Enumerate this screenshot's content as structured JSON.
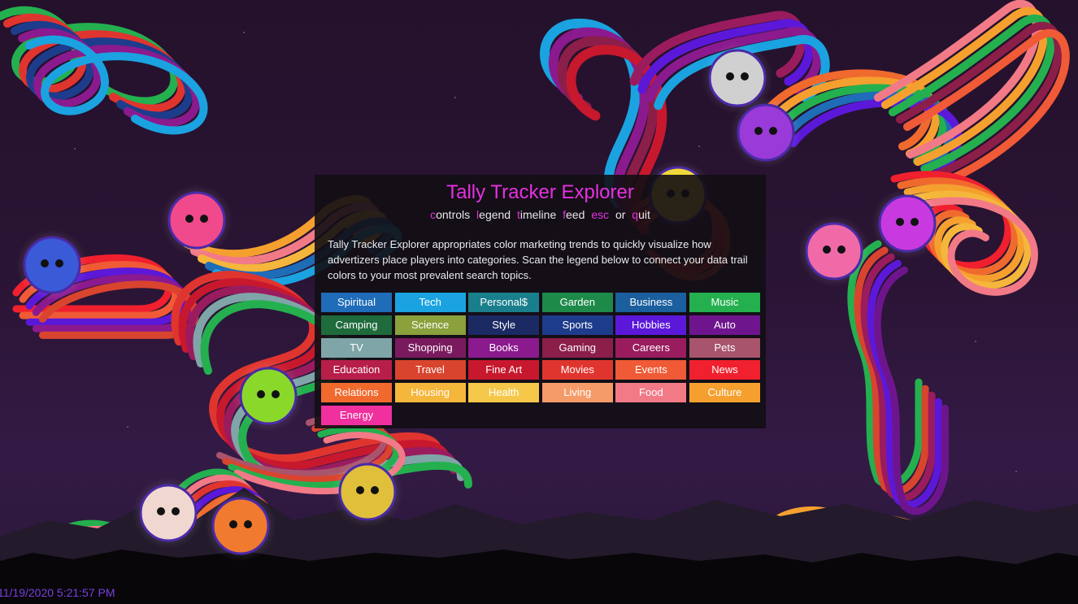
{
  "app": {
    "title": "Tally Tracker Explorer",
    "menu": [
      {
        "key": "c",
        "rest": "ontrols"
      },
      {
        "key": "l",
        "rest": "egend"
      },
      {
        "key": "t",
        "rest": "imeline"
      },
      {
        "key": "f",
        "rest": "eed"
      },
      {
        "key": "esc",
        "rest": ""
      },
      {
        "key": "",
        "rest": "or"
      },
      {
        "key": "q",
        "rest": "uit"
      }
    ],
    "description": "Tally Tracker Explorer appropriates color marketing trends to quickly visualize how advertizers place players into categories. Scan the legend below to connect your data trail colors to your most prevalent search topics."
  },
  "legend": [
    {
      "label": "Spiritual",
      "color": "#1f6cb8"
    },
    {
      "label": "Tech",
      "color": "#1aa3e0"
    },
    {
      "label": "Personal$",
      "color": "#1a7f8c"
    },
    {
      "label": "Garden",
      "color": "#1d8a4a"
    },
    {
      "label": "Business",
      "color": "#1b5f9e"
    },
    {
      "label": "Music",
      "color": "#24b04e"
    },
    {
      "label": "Camping",
      "color": "#1f6b3c"
    },
    {
      "label": "Science",
      "color": "#8aa13c"
    },
    {
      "label": "Style",
      "color": "#1c2a63"
    },
    {
      "label": "Sports",
      "color": "#1e3c8c"
    },
    {
      "label": "Hobbies",
      "color": "#5c18d9"
    },
    {
      "label": "Auto",
      "color": "#6e158e"
    },
    {
      "label": "TV",
      "color": "#7fa5a8"
    },
    {
      "label": "Shopping",
      "color": "#7a1a5e"
    },
    {
      "label": "Books",
      "color": "#8b1a8e"
    },
    {
      "label": "Gaming",
      "color": "#8c1e4a"
    },
    {
      "label": "Careers",
      "color": "#9a1c5e"
    },
    {
      "label": "Pets",
      "color": "#a8546c"
    },
    {
      "label": "Education",
      "color": "#b81e4a"
    },
    {
      "label": "Travel",
      "color": "#d9442e"
    },
    {
      "label": "Fine Art",
      "color": "#c8182e"
    },
    {
      "label": "Movies",
      "color": "#e0352f"
    },
    {
      "label": "Events",
      "color": "#f05a36"
    },
    {
      "label": "News",
      "color": "#f0202e"
    },
    {
      "label": "Relations",
      "color": "#f06a2e"
    },
    {
      "label": "Housing",
      "color": "#f5b63c"
    },
    {
      "label": "Health",
      "color": "#f5c84a"
    },
    {
      "label": "Living",
      "color": "#f59b6a"
    },
    {
      "label": "Food",
      "color": "#f27a86"
    },
    {
      "label": "Culture",
      "color": "#f5a02e"
    },
    {
      "label": "Energy",
      "color": "#f0309e"
    }
  ],
  "timestamp": "11/19/2020 5:21:57 PM",
  "players": [
    {
      "name": "player-pink-zigzag",
      "color": "#f04a8c"
    },
    {
      "name": "player-blue-glasses",
      "color": "#3a5ad8"
    },
    {
      "name": "player-green-yellow",
      "color": "#8ad82a"
    },
    {
      "name": "player-floral",
      "color": "#f0d8d0"
    },
    {
      "name": "player-orange",
      "color": "#f07a2e"
    },
    {
      "name": "player-blue-glasses-2",
      "color": "#e0c03a"
    },
    {
      "name": "player-silver-foil",
      "color": "#d0d0d0"
    },
    {
      "name": "player-purple-eyes",
      "color": "#9a3ad8"
    },
    {
      "name": "player-pink-sunglasses",
      "color": "#f06aa8"
    },
    {
      "name": "player-magenta-checks",
      "color": "#c83ae0"
    },
    {
      "name": "player-yellow-top",
      "color": "#f0d83a"
    }
  ]
}
